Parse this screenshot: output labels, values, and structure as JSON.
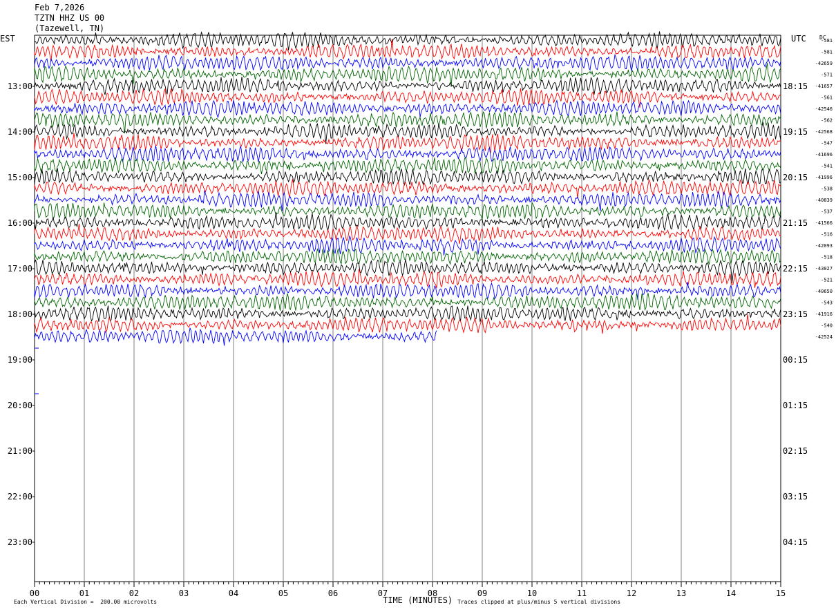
{
  "header": {
    "date": "Feb 7,2026",
    "station": "TZTN HHZ US 00",
    "location": "(Tazewell, TN)"
  },
  "labels": {
    "left_tz": "EST",
    "right_tz": "UTC",
    "dc": "DC",
    "xlabel": "TIME (MINUTES)",
    "scale_note": "Each Vertical Division =  200.00 microvolts",
    "clip_note": "Traces clipped at plus/minus 5 vertical divisions"
  },
  "colors": {
    "cycle": [
      "#000000",
      "#ff0000",
      "#0000ff",
      "#006400"
    ]
  },
  "chart_data": {
    "type": "line",
    "x_ticks": [
      "00",
      "01",
      "02",
      "03",
      "04",
      "05",
      "06",
      "07",
      "08",
      "09",
      "10",
      "11",
      "12",
      "13",
      "14",
      "15"
    ],
    "xlim": [
      0,
      15
    ],
    "left_hour_labels": [
      "13:00",
      "14:00",
      "15:00",
      "16:00",
      "17:00",
      "18:00",
      "19:00",
      "20:00",
      "21:00",
      "22:00",
      "23:00"
    ],
    "right_hour_labels": [
      "18:15",
      "19:15",
      "20:15",
      "21:15",
      "22:15",
      "23:15",
      "00:15",
      "01:15",
      "02:15",
      "03:15",
      "04:15"
    ],
    "trace_count": 27,
    "last_trace_end_minute": 8.1,
    "dc_offsets": [
      "-581",
      "-581",
      "-42659",
      "-571",
      "-41657",
      "-561",
      "-42546",
      "-562",
      "-42568",
      "-547",
      "-41696",
      "-541",
      "-41996",
      "-538",
      "-40839",
      "-537",
      "-41566",
      "-516",
      "-42093",
      "-518",
      "-43027",
      "-521",
      "-40650",
      "-543",
      "-41916",
      "-540",
      "-42524"
    ]
  }
}
